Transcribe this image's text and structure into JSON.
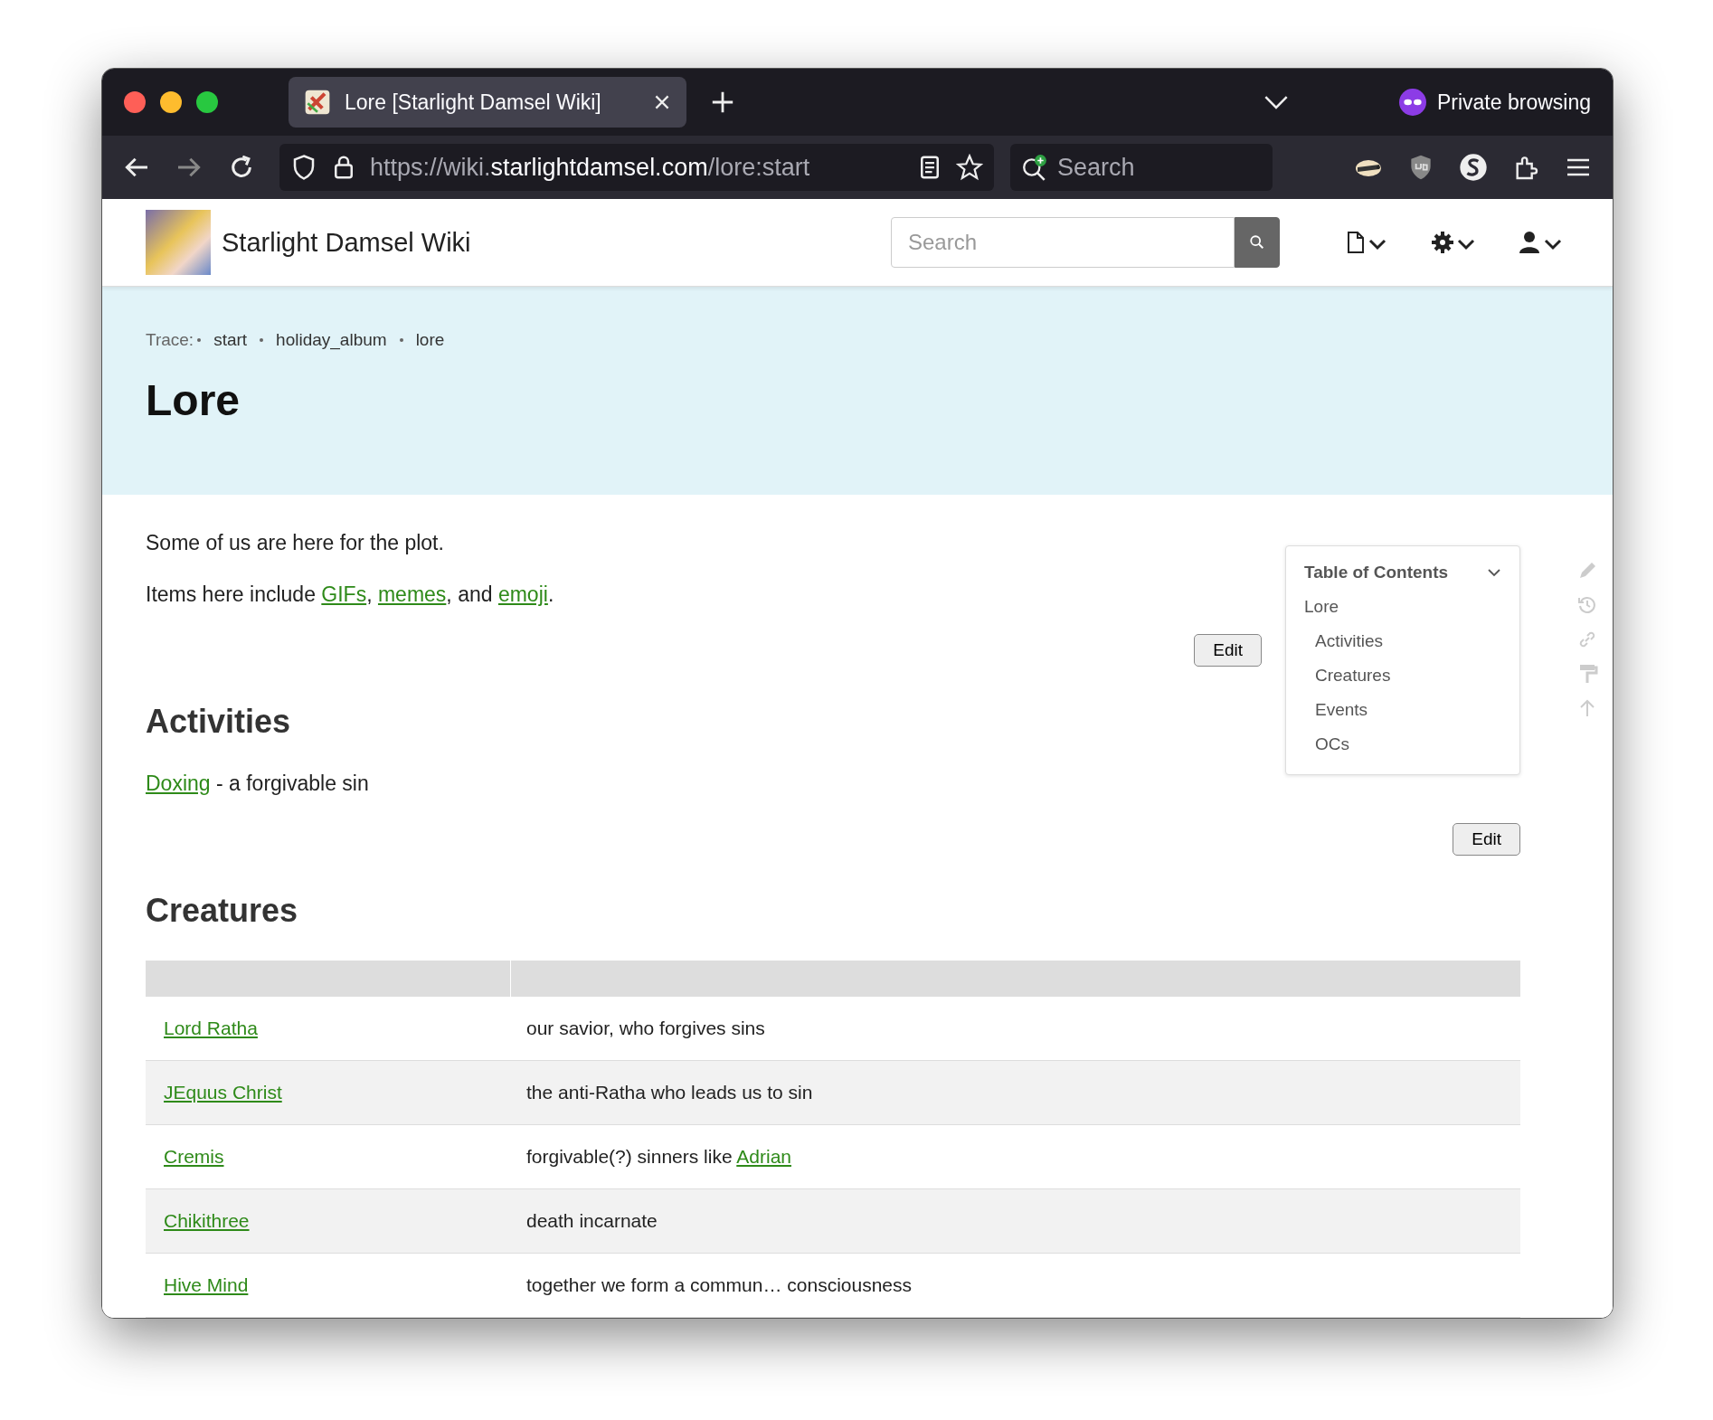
{
  "browser": {
    "tabs": [
      {
        "title": "Lore [Starlight Damsel Wiki]",
        "selected": true
      }
    ],
    "private_label": "Private browsing",
    "url": {
      "prefix": "https://wiki.",
      "domain": "starlightdamsel.com",
      "path": "/lore:start"
    },
    "search": {
      "placeholder": "Search"
    }
  },
  "site": {
    "name": "Starlight Damsel Wiki",
    "search": {
      "placeholder": "Search"
    }
  },
  "breadcrumb": {
    "label": "Trace:",
    "items": [
      "start",
      "holiday_album",
      "lore"
    ]
  },
  "title": "Lore",
  "intro": [
    [
      {
        "kind": "text",
        "text": "Some of us are here for the plot."
      }
    ],
    [
      {
        "kind": "text",
        "text": "Items here include "
      },
      {
        "kind": "link",
        "text": "GIFs"
      },
      {
        "kind": "text",
        "text": ", "
      },
      {
        "kind": "link",
        "text": "memes"
      },
      {
        "kind": "text",
        "text": ", and "
      },
      {
        "kind": "link",
        "text": "emoji"
      },
      {
        "kind": "text",
        "text": "."
      }
    ]
  ],
  "intro_edit": "Edit",
  "sections": [
    {
      "heading": "Activities",
      "kind": "text",
      "lines": [
        [
          {
            "kind": "link",
            "text": "Doxing"
          },
          {
            "kind": "text",
            "text": " - a forgivable sin"
          }
        ]
      ],
      "edit": "Edit"
    },
    {
      "heading": "Creatures",
      "kind": "table",
      "rows": [
        {
          "name": "Lord Ratha",
          "desc": [
            {
              "kind": "text",
              "text": "our savior, who forgives sins"
            }
          ]
        },
        {
          "name": "JEquus Christ",
          "desc": [
            {
              "kind": "text",
              "text": "the anti-Ratha who leads us to sin"
            }
          ]
        },
        {
          "name": "Cremis",
          "desc": [
            {
              "kind": "text",
              "text": "forgivable(?) sinners like "
            },
            {
              "kind": "link",
              "text": "Adrian"
            }
          ]
        },
        {
          "name": "Chikithree",
          "desc": [
            {
              "kind": "text",
              "text": "death incarnate"
            }
          ]
        },
        {
          "name": "Hive Mind",
          "desc": [
            {
              "kind": "text",
              "text": "together we form a commun… consciousness"
            }
          ]
        }
      ]
    }
  ],
  "toc": {
    "title": "Table of Contents",
    "expanded": true,
    "items": [
      {
        "label": "Lore",
        "children": [
          {
            "label": "Activities"
          },
          {
            "label": "Creatures"
          },
          {
            "label": "Events"
          },
          {
            "label": "OCs"
          }
        ]
      }
    ]
  }
}
